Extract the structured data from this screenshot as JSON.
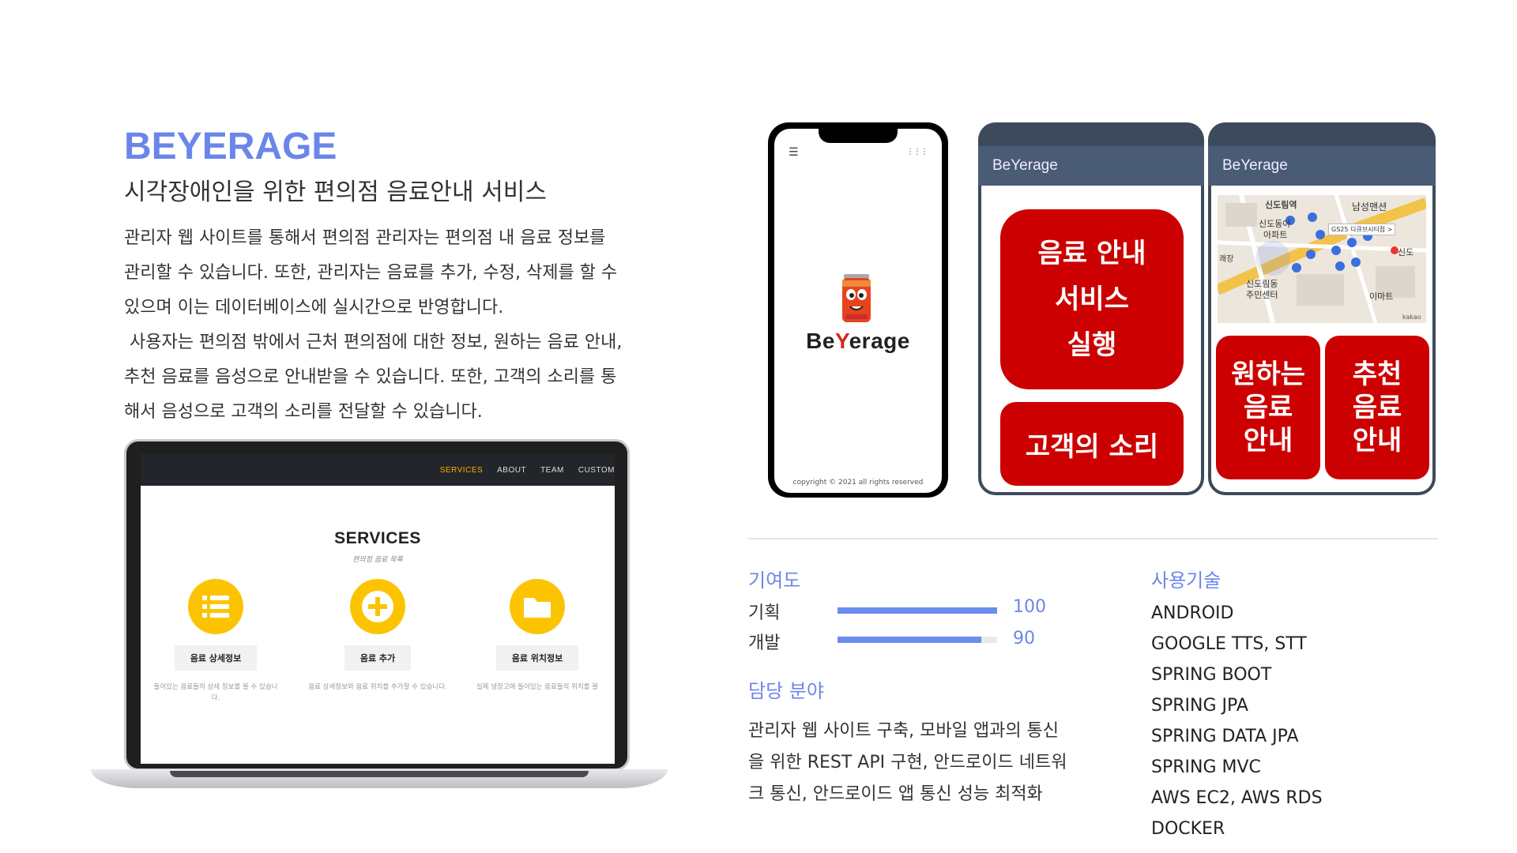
{
  "project": {
    "title": "BEYERAGE",
    "subtitle": "시각장애인을 위한 편의점 음료안내 서비스",
    "description_lines": [
      "관리자 웹 사이트를 통해서 편의점 관리자는 편의점 내 음료 정보를",
      "관리할 수 있습니다. 또한, 관리자는 음료를 추가, 수정, 삭제를 할 수",
      "있으며 이는 데이터베이스에 실시간으로 반영합니다.",
      " 사용자는 편의점 밖에서 근처 편의점에 대한 정보, 원하는 음료 안내,",
      "추천 음료를 음성으로 안내받을 수 있습니다. 또한, 고객의 소리를 통",
      "해서 음성으로 고객의 소리를 전달할 수 있습니다."
    ]
  },
  "laptop": {
    "nav": [
      "SERVICES",
      "ABOUT",
      "TEAM",
      "CUSTOM"
    ],
    "services_title": "SERVICES",
    "services_subtitle": "편의점 음료 목록",
    "services": [
      {
        "label": "음료 상세정보",
        "text": "들어있는 음료들의 상세 정보를 볼 수 있습니",
        "text2": "다.",
        "icon": "list-icon"
      },
      {
        "label": "음료 추가",
        "text": "음료 상세정보와 음료 위치를 추가할 수 있습니다.",
        "text2": "",
        "icon": "plus-icon"
      },
      {
        "label": "음료 위치정보",
        "text": "실제 냉장고에 들어있는 음료들의 위치를 볼",
        "text2": "",
        "icon": "folder-icon"
      }
    ]
  },
  "phone1": {
    "brand_parts": [
      "Be",
      "Y",
      "e",
      "rage"
    ],
    "copyright": "copyright © 2021 all rights reserved"
  },
  "phone2": {
    "app_title": "BeYerage",
    "main_button_lines": [
      "음료 안내",
      "서비스",
      "실행"
    ],
    "voice_button": "고객의 소리"
  },
  "phone3": {
    "app_title": "BeYerage",
    "map_labels": [
      "신도림역",
      "남성맨션",
      "신도동아",
      "아파트",
      "GS25 디큐브시티점 >",
      "신도",
      "신도림동",
      "주민센터",
      "이마트",
      "kakao",
      "쾌장"
    ],
    "left_button_lines": [
      "원하는",
      "음료",
      "안내"
    ],
    "right_button_lines": [
      "추천",
      "음료",
      "안내"
    ]
  },
  "contribution": {
    "title": "기여도",
    "items": [
      {
        "label": "기획",
        "value": 100
      },
      {
        "label": "개발",
        "value": 90
      }
    ]
  },
  "role": {
    "title": "담당 분야",
    "lines": [
      "관리자 웹 사이트 구축, 모바일 앱과의 통신",
      "을 위한 REST API 구현, 안드로이드 네트워",
      "크 통신, 안드로이드 앱 통신 성능 최적화"
    ]
  },
  "tech": {
    "title": "사용기술",
    "items": [
      "ANDROID",
      "GOOGLE TTS, STT",
      "SPRING BOOT",
      "SPRING JPA",
      "SPRING DATA JPA",
      "SPRING MVC",
      "AWS EC2, AWS RDS",
      "DOCKER"
    ]
  },
  "colors": {
    "accent": "#6b86ea",
    "red_button": "#cc0000",
    "app_bar": "#4a5b75",
    "service_circle": "#fcc400"
  }
}
